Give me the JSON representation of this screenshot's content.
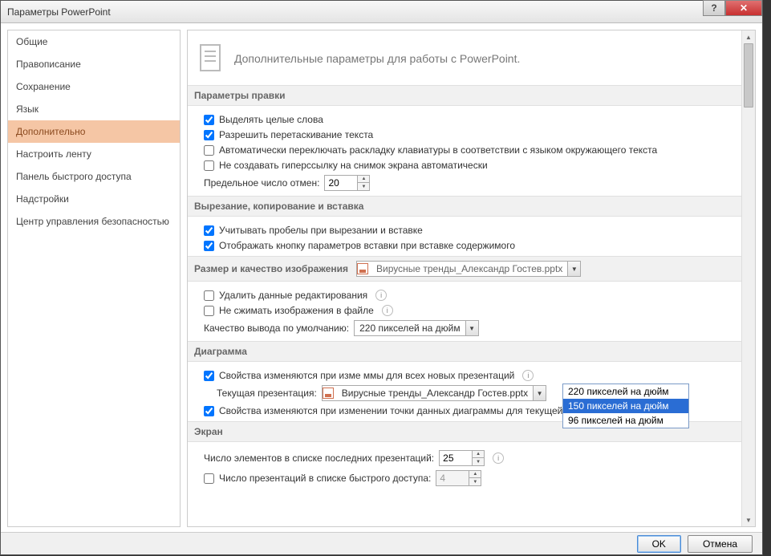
{
  "window": {
    "title": "Параметры PowerPoint"
  },
  "sidebar": {
    "items": [
      {
        "label": "Общие"
      },
      {
        "label": "Правописание"
      },
      {
        "label": "Сохранение"
      },
      {
        "label": "Язык"
      },
      {
        "label": "Дополнительно",
        "selected": true
      },
      {
        "label": "Настроить ленту"
      },
      {
        "label": "Панель быстрого доступа"
      },
      {
        "label": "Надстройки"
      },
      {
        "label": "Центр управления безопасностью"
      }
    ]
  },
  "header": {
    "text": "Дополнительные параметры для работы с PowerPoint."
  },
  "sections": {
    "edit": {
      "title": "Параметры правки",
      "opt1": "Выделять целые слова",
      "opt2": "Разрешить перетаскивание текста",
      "opt3": "Автоматически переключать раскладку клавиатуры в соответствии с языком окружающего текста",
      "opt4": "Не создавать гиперссылку на снимок экрана автоматически",
      "undo_label": "Предельное число отмен:",
      "undo_value": "20"
    },
    "clip": {
      "title": "Вырезание, копирование и вставка",
      "opt1": "Учитывать пробелы при вырезании и вставке",
      "opt2": "Отображать кнопку параметров вставки при вставке содержимого"
    },
    "image": {
      "title": "Размер и качество изображения",
      "file": "Вирусные тренды_Александр Гостев.pptx",
      "opt1": "Удалить данные редактирования",
      "opt2": "Не сжимать изображения в файле",
      "quality_label": "Качество вывода по умолчанию:",
      "quality_value": "220 пикселей на дюйм",
      "quality_options": [
        "220 пикселей на дюйм",
        "150 пикселей на дюйм",
        "96 пикселей на дюйм"
      ]
    },
    "chart": {
      "title": "Диаграмма",
      "opt1": "Свойства изменяются при изме                                              ммы для всех новых презентаций",
      "presentation_label": "Текущая презентация:",
      "presentation_file": "Вирусные тренды_Александр Гостев.pptx",
      "opt2": "Свойства изменяются при изменении точки данных диаграммы для текущей презентации"
    },
    "screen": {
      "title": "Экран",
      "recent_label": "Число элементов в списке последних презентаций:",
      "recent_value": "25",
      "pinned_label": "Число презентаций в списке быстрого доступа:",
      "pinned_value": "4"
    }
  },
  "footer": {
    "ok": "OK",
    "cancel": "Отмена"
  }
}
